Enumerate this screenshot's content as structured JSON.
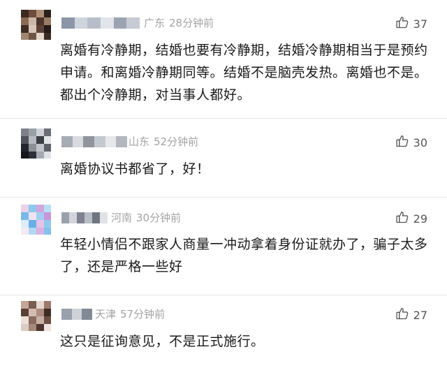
{
  "comments": [
    {
      "location": "广东",
      "time": "28分钟前",
      "likes": "37",
      "text": "离婚有冷静期，结婚也要有冷静期，结婚冷静期相当于是预约申请。和离婚冷静期同等。结婚不是脑壳发热。离婚也不是。都出个冷静期，对当事人都好。",
      "avatar_colors": [
        "#3a2a22",
        "#6f4d3a",
        "#b08f78",
        "#2b211c",
        "#8a6a55",
        "#cbb7a5",
        "#4a352b",
        "#9a7b66",
        "#3d2d25",
        "#d8c6b8",
        "#5b4234",
        "#231a16",
        "#a08572",
        "#705443",
        "#e2d5ca",
        "#3a2b23"
      ],
      "name_colors": [
        "#8d96a8",
        "#cfd3dc",
        "#b8bec9",
        "#e1e4ea",
        "#9ca3b1",
        "#c6cbd4"
      ]
    },
    {
      "location": "山东",
      "time": "52分钟前",
      "likes": "30",
      "text": "离婚协议书都省了，好！",
      "avatar_colors": [
        "#7d8087",
        "#9aa0a8",
        "#cfd2d6",
        "#6b6e75",
        "#505359",
        "#b6bac0",
        "#3b3e44",
        "#e3e5e8",
        "#22252b",
        "#8d9097",
        "#c1c4c9",
        "#5e6168",
        "#141619",
        "#2d3036",
        "#a5a9af",
        "#dfe1e4"
      ],
      "name_colors": [
        "#a7abb3",
        "#d7dae0",
        "#8f949d",
        "#c4c8cf",
        "#e6e8ec",
        "#b3b7bf"
      ]
    },
    {
      "location": "河南",
      "time": "30分钟前",
      "likes": "29",
      "text": "年轻小情侣不跟家人商量一冲动拿着身份证就办了，骗子太多了，还是严格一些好",
      "avatar_colors": [
        "#e9d3e8",
        "#8ec7ee",
        "#d0a6dd",
        "#b8dff5",
        "#79b9ea",
        "#efe3f0",
        "#a2cff1",
        "#c995d8",
        "#dcedf9",
        "#6aaee6",
        "#e4c3e6",
        "#93c8ee",
        "#f3eaf4",
        "#b2d8f3",
        "#d9b2e2",
        "#85c0ec"
      ],
      "name_colors": [
        "#9aa0ab",
        "#d2d5db",
        "#7d8490",
        "#b9bdc5",
        "#6f7682",
        "#e0e2e6"
      ]
    },
    {
      "location": "天津",
      "time": "57分钟前",
      "likes": "27",
      "text": "这只是征询意见，不是正式施行。",
      "avatar_colors": [
        "#c4a698",
        "#7b5c50",
        "#e6d7cf",
        "#9c7a6c",
        "#5a4036",
        "#d3bdb2",
        "#ae8d80",
        "#3f2c25",
        "#ecdfd8",
        "#8a6a5d",
        "#c9b0a4",
        "#6d4f44",
        "#dccbc2",
        "#a4887c",
        "#4d362e",
        "#f0e6e1"
      ],
      "name_colors": [
        "#9aa1ac",
        "#cdd1d8",
        "#828a96"
      ]
    }
  ]
}
